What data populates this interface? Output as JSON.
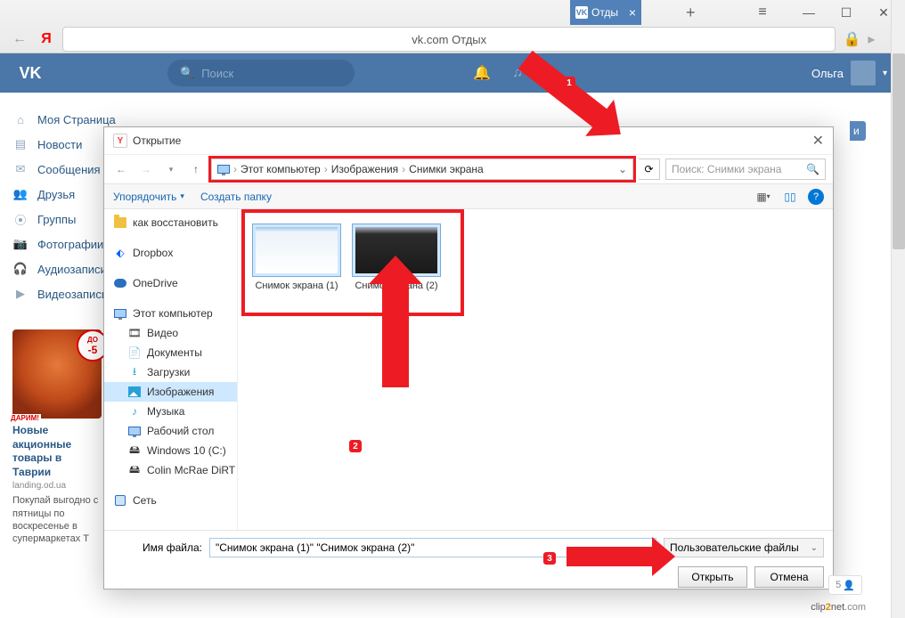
{
  "browser": {
    "tab": {
      "title": "Отды",
      "favicon_text": "VK"
    },
    "address_text": "vk.com Отдых"
  },
  "window_controls": {
    "menu": "≡",
    "minimize": "—",
    "maximize": "☐",
    "close": "✕"
  },
  "vk": {
    "search_placeholder": "Поиск",
    "username": "Ольга",
    "menu": [
      {
        "icon": "home",
        "label": "Моя Страница"
      },
      {
        "icon": "news",
        "label": "Новости"
      },
      {
        "icon": "msg",
        "label": "Сообщения"
      },
      {
        "icon": "friends",
        "label": "Друзья"
      },
      {
        "icon": "groups",
        "label": "Группы"
      },
      {
        "icon": "photo",
        "label": "Фотографии"
      },
      {
        "icon": "audio",
        "label": "Аудиозаписи"
      },
      {
        "icon": "video",
        "label": "Видеозаписи"
      }
    ],
    "right_button_peek": "и"
  },
  "ad": {
    "badge_top": "ДО",
    "badge_value": "-5",
    "badge_sub": "ДАРИМ!",
    "heading": "Новые акционные товары в Таврии",
    "domain": "landing.od.ua",
    "description": "Покупай выгодно с пятницы по воскресенье в супермаркетах Т"
  },
  "dialog": {
    "title": "Открытие",
    "breadcrumb": [
      "Этот компьютер",
      "Изображения",
      "Снимки экрана"
    ],
    "search_placeholder": "Поиск: Снимки экрана",
    "toolbar": {
      "organize": "Упорядочить",
      "new_folder": "Создать папку"
    },
    "tree": {
      "top": "как восстановить",
      "cloud": [
        "Dropbox",
        "OneDrive"
      ],
      "this_pc": "Этот компьютер",
      "this_pc_children": [
        "Видео",
        "Документы",
        "Загрузки",
        "Изображения",
        "Музыка",
        "Рабочий стол",
        "Windows 10 (C:)",
        "Colin McRae DiRT"
      ],
      "network": "Сеть"
    },
    "files": [
      {
        "name": "Снимок экрана (1)"
      },
      {
        "name": "Снимок экрана (2)"
      }
    ],
    "filename_label": "Имя файла:",
    "filename_value": "\"Снимок экрана (1)\" \"Снимок экрана (2)\"",
    "filter_label": "Пользовательские файлы",
    "open_btn": "Открыть",
    "cancel_btn": "Отмена"
  },
  "annotations": {
    "b1": "1",
    "b2": "2",
    "b3": "3"
  },
  "followers_count": "5",
  "watermark": "clip2net.com"
}
